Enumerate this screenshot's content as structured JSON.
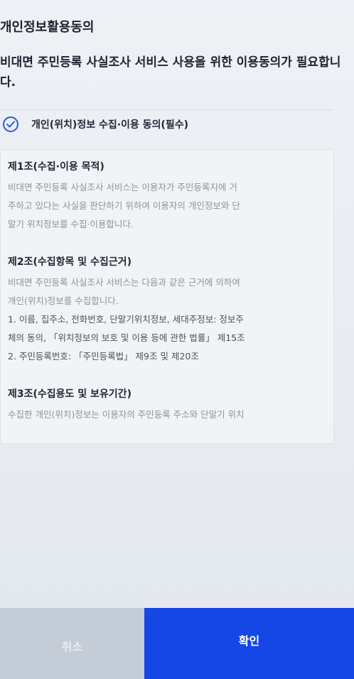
{
  "header": {
    "title": "개인정보활용동의",
    "description": "비대면 주민등록 사실조사 서비스 사용을 위한 이용동의가 필요합니다."
  },
  "consent": {
    "label": "개인(위치)정보 수집·이용 동의(필수)",
    "checked": true,
    "accent_color": "#2a5bd7"
  },
  "terms": {
    "articles": [
      {
        "title": "제1조(수집·이용 목적)",
        "lines": [
          "비대면 주민등록 사실조사 서비스는 이용자가 주민등록지에 거",
          "주하고 있다는 사실을 판단하기 위하여 이용자의 개인정보와 단",
          "말기 위치정보를 수집·이용합니다."
        ]
      },
      {
        "title": "제2조(수집항목 및 수집근거)",
        "lines": [
          "비대면 주민등록 사실조사 서비스는 다음과 같은 근거에 의하여",
          "개인(위치)정보를 수집합니다."
        ],
        "items": [
          "1. 이름, 집주소, 전화번호, 단말기위치정보, 세대주정보: 정보주",
          "체의 동의, 「위치정보의 보호 및 이용 등에 관한 법률」 제15조",
          "2. 주민등록번호: 「주민등록법」 제9조 및 제20조"
        ]
      },
      {
        "title": "제3조(수집용도 및 보유기간)",
        "lines": [
          "수집한 개인(위치)정보는 이용자의 주민등록 주소와 단말기 위치"
        ]
      }
    ]
  },
  "buttons": {
    "cancel_label": "취소",
    "confirm_label": "확인",
    "confirm_color": "#1447e6",
    "cancel_color": "#c4ccd8"
  }
}
